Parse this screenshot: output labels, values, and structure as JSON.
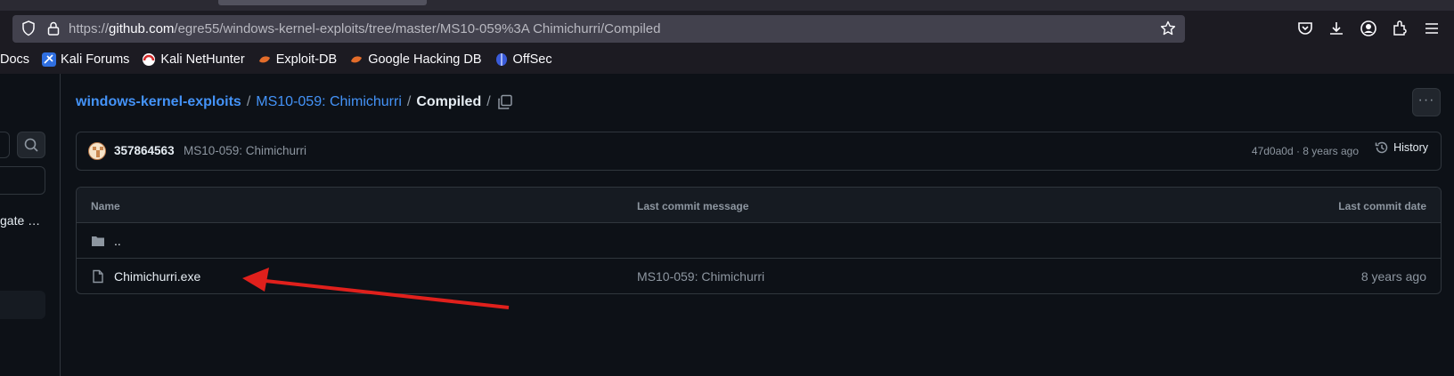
{
  "browser": {
    "url_prefix": "https://",
    "url_host": "github.com",
    "url_path": "/egre55/windows-kernel-exploits/tree/master/MS10-059%3A Chimichurri/Compiled"
  },
  "bookmarks": [
    {
      "label": "Docs",
      "icon": "docs-icon"
    },
    {
      "label": "Kali Forums",
      "icon": "kali-forums-icon"
    },
    {
      "label": "Kali NetHunter",
      "icon": "nethunter-icon"
    },
    {
      "label": "Exploit-DB",
      "icon": "exploitdb-icon"
    },
    {
      "label": "Google Hacking DB",
      "icon": "ghdb-icon"
    },
    {
      "label": "OffSec",
      "icon": "offsec-icon"
    }
  ],
  "sidebar": {
    "truncated_item": "gate …"
  },
  "breadcrumb": {
    "repo": "windows-kernel-exploits",
    "folder": "MS10-059: Chimichurri",
    "current": "Compiled",
    "sep1": "/",
    "sep2": "/",
    "sep3": "/"
  },
  "commit": {
    "author": "357864563",
    "message": "MS10-059: Chimichurri",
    "meta": "47d0a0d · 8 years ago",
    "history_label": "History"
  },
  "table": {
    "headers": {
      "name": "Name",
      "message": "Last commit message",
      "date": "Last commit date"
    },
    "rows": [
      {
        "name": "..",
        "message": "",
        "date": "",
        "type": "folder"
      },
      {
        "name": "Chimichurri.exe",
        "message": "MS10-059: Chimichurri",
        "date": "8 years ago",
        "type": "file"
      }
    ]
  },
  "more_button": "···",
  "colors": {
    "accent": "#4493f8",
    "arrow": "#e0201c",
    "bg": "#0d1117"
  }
}
